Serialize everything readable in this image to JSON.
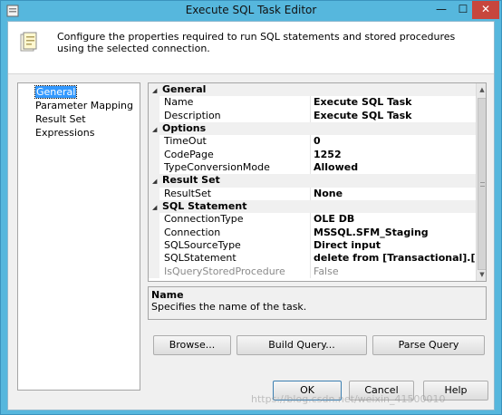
{
  "window": {
    "title": "Execute SQL Task Editor",
    "minimize_glyph": "—",
    "maximize_glyph": "☐",
    "close_glyph": "✕"
  },
  "header": {
    "description": "Configure the properties required to run SQL statements and stored procedures using the selected connection."
  },
  "nav": {
    "items": [
      {
        "label": "General",
        "selected": true
      },
      {
        "label": "Parameter Mapping",
        "selected": false
      },
      {
        "label": "Result Set",
        "selected": false
      },
      {
        "label": "Expressions",
        "selected": false
      }
    ]
  },
  "grid": {
    "categories": [
      {
        "label": "General",
        "rows": [
          {
            "name": "Name",
            "value": "Execute SQL Task"
          },
          {
            "name": "Description",
            "value": "Execute SQL Task"
          }
        ]
      },
      {
        "label": "Options",
        "rows": [
          {
            "name": "TimeOut",
            "value": "0"
          },
          {
            "name": "CodePage",
            "value": "1252"
          },
          {
            "name": "TypeConversionMode",
            "value": "Allowed"
          }
        ]
      },
      {
        "label": "Result Set",
        "rows": [
          {
            "name": "ResultSet",
            "value": "None"
          }
        ]
      },
      {
        "label": "SQL Statement",
        "rows": [
          {
            "name": "ConnectionType",
            "value": "OLE DB"
          },
          {
            "name": "Connection",
            "value": "MSSQL.SFM_Staging"
          },
          {
            "name": "SQLSourceType",
            "value": "Direct input"
          },
          {
            "name": "SQLStatement",
            "value": "delete from [Transactional].[Consumer"
          },
          {
            "name": "IsQueryStoredProcedure",
            "value": "False",
            "disabled": true
          }
        ]
      }
    ]
  },
  "description_panel": {
    "title": "Name",
    "text": "Specifies the name of the task."
  },
  "buttons": {
    "browse": "Browse...",
    "build_query": "Build Query...",
    "parse_query": "Parse Query",
    "ok": "OK",
    "cancel": "Cancel",
    "help": "Help"
  },
  "watermark": "https://blog.csdn.net/weixin_41500010",
  "colors": {
    "titlebar": "#56b7dd",
    "close_button": "#c7463d",
    "selection": "#3399ff"
  }
}
